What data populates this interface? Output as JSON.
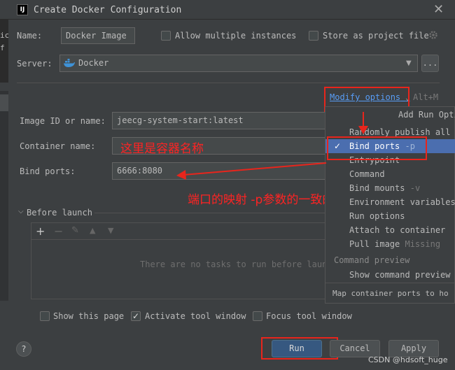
{
  "window": {
    "title": "Create Docker Configuration",
    "app_icon": "intellij-icon",
    "app_icon_text": "IJ",
    "close_icon": "close-icon"
  },
  "left_strip_text": [
    "ic",
    "f"
  ],
  "form": {
    "name_label": "Name:",
    "name_value": "Docker Image",
    "allow_multiple_label": "Allow multiple instances",
    "store_project_label": "Store as project file",
    "server_label": "Server:",
    "server_value": "Docker",
    "browse_label": "...",
    "modify_options_label": "Modify options",
    "modify_shortcut": "Alt+M",
    "image_label": "Image ID or name:",
    "image_value": "jeecg-system-start:latest",
    "container_label": "Container name:",
    "container_value": "",
    "ports_label": "Bind ports:",
    "ports_value": "6666:8080"
  },
  "annotations": {
    "container_note": "这里是容器名称",
    "ports_note": "端口的映射 -p参数的一致的"
  },
  "before_launch": {
    "title": "Before launch",
    "empty_text": "There are no tasks to run before launch"
  },
  "footer": {
    "show_page_label": "Show this page",
    "activate_label": "Activate tool window",
    "focus_label": "Focus tool window",
    "run_label": "Run",
    "cancel_label": "Cancel",
    "apply_label": "Apply",
    "help_label": "?"
  },
  "popup": {
    "header": "Add Run Opti",
    "items": [
      {
        "label": "Randomly publish all e",
        "hint": ""
      },
      {
        "label": "Bind ports",
        "hint": "-p",
        "selected": true
      },
      {
        "label": "Entrypoint",
        "hint": ""
      },
      {
        "label": "Command",
        "hint": ""
      },
      {
        "label": "Bind mounts",
        "hint": "-v"
      },
      {
        "label": "Environment variables",
        "hint": ""
      },
      {
        "label": "Run options",
        "hint": ""
      },
      {
        "label": "Attach to container",
        "hint": ""
      },
      {
        "label": "Pull image",
        "hint": "Missing"
      }
    ],
    "section2_header": "Command preview",
    "show_preview": "Show command preview",
    "footer_text": "Map container ports to ho"
  },
  "watermark": "CSDN @hdsoft_huge",
  "colors": {
    "background": "#3c3f41",
    "field": "#45494a",
    "selection": "#4b6eaf",
    "primary_button": "#365880",
    "annotation_red": "#e8251c",
    "link_blue": "#589df6"
  }
}
